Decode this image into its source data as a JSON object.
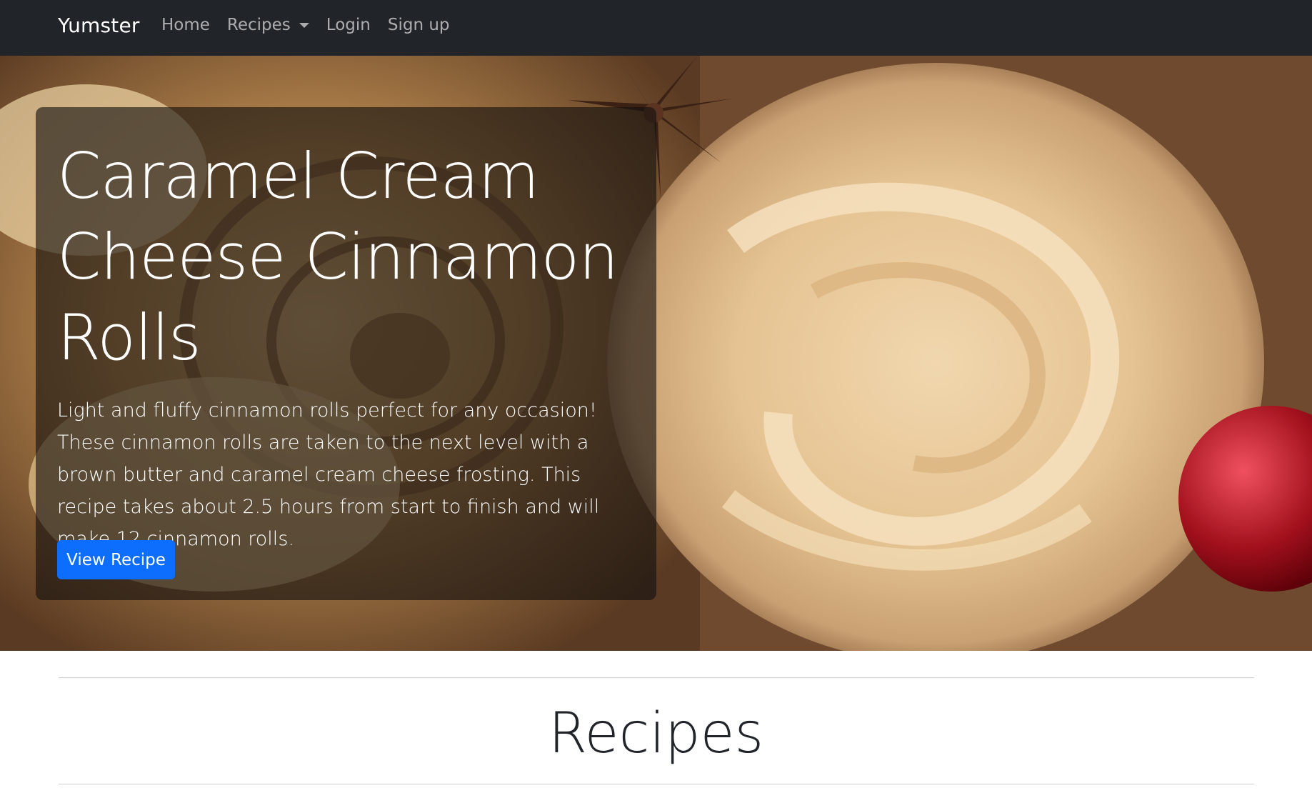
{
  "navbar": {
    "brand": "Yumster",
    "links": [
      {
        "label": "Home"
      },
      {
        "label": "Recipes",
        "dropdown": true
      },
      {
        "label": "Login"
      },
      {
        "label": "Sign up"
      }
    ]
  },
  "hero": {
    "title": "Caramel Cream Cheese Cinnamon Rolls",
    "description": "Light and fluffy cinnamon rolls perfect for any occasion! These cinnamon rolls are taken to the next level with a brown butter and caramel cream cheese frosting. This recipe takes about 2.5 hours from start to finish and will make 12 cinnamon rolls.",
    "button_label": "View Recipe",
    "image_subject": "cinnamon-rolls-with-frosting-photo"
  },
  "section": {
    "title": "Recipes"
  },
  "colors": {
    "navbar_bg": "#212529",
    "primary": "#0d6efd"
  }
}
